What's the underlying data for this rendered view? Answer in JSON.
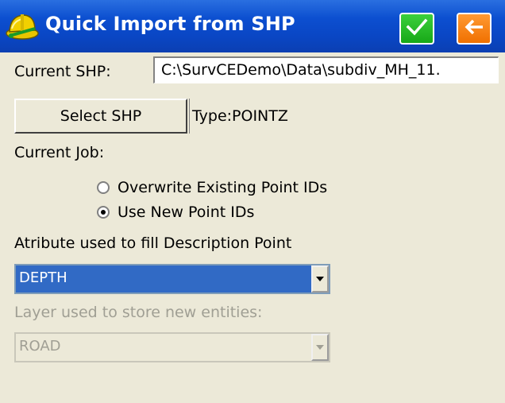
{
  "window": {
    "title": "Quick Import from SHP"
  },
  "icons": {
    "app": "surveyor-helmet-icon",
    "ok": "checkmark-icon",
    "back": "back-arrow-icon",
    "dropdown": "chevron-down-icon"
  },
  "colors": {
    "titlebar": "#0a46c4",
    "ok_button": "#17a817",
    "back_button": "#f07000",
    "selection": "#316ac5",
    "background": "#ece9d8"
  },
  "form": {
    "current_shp_label": "Current SHP:",
    "current_shp_value": "C:\\SurvCEDemo\\Data\\subdiv_MH_11.",
    "select_button": "Select SHP",
    "type_label": "Type:POINTZ",
    "current_job_label": "Current Job:",
    "radio_options": [
      {
        "label": "Overwrite Existing Point IDs",
        "selected": false
      },
      {
        "label": "Use New Point IDs",
        "selected": true
      }
    ],
    "attribute_label": "Atribute used to fill Description Point",
    "attribute_value": "DEPTH",
    "layer_label": "Layer used to store new entities:",
    "layer_value": "ROAD",
    "layer_enabled": false
  }
}
